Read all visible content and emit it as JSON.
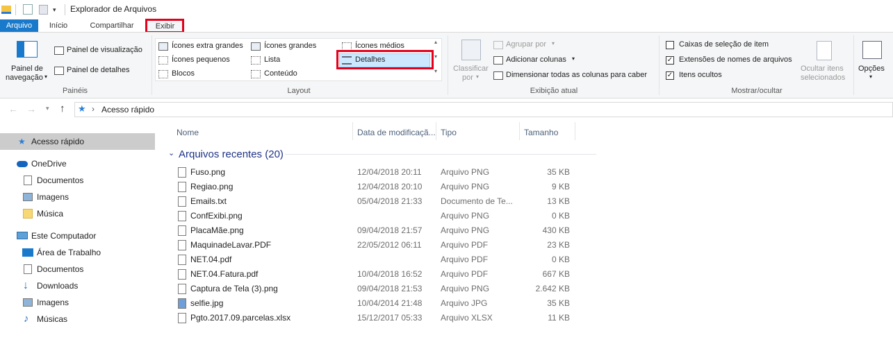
{
  "window": {
    "title": "Explorador de Arquivos"
  },
  "tabs": {
    "file": "Arquivo",
    "home": "Início",
    "share": "Compartilhar",
    "view": "Exibir"
  },
  "ribbon": {
    "panes": {
      "nav_pane": "Painel de",
      "nav_pane2": "navegação",
      "preview": "Painel de visualização",
      "details": "Painel de detalhes",
      "group": "Painéis"
    },
    "layout": {
      "xl": "Ícones extra grandes",
      "large": "Ícones grandes",
      "medium": "Ícones médios",
      "small": "Ícones pequenos",
      "list": "Lista",
      "details": "Detalhes",
      "tiles": "Blocos",
      "content": "Conteúdo",
      "group": "Layout"
    },
    "current": {
      "sort1": "Classificar",
      "sort2": "por",
      "group_by": "Agrupar por",
      "add_cols": "Adicionar colunas",
      "fit_cols": "Dimensionar todas as colunas para caber",
      "group": "Exibição atual"
    },
    "showhide": {
      "checkboxes": "Caixas de seleção de item",
      "extensions": "Extensões de nomes de arquivos",
      "hidden": "Itens ocultos",
      "hide_sel1": "Ocultar itens",
      "hide_sel2": "selecionados",
      "group": "Mostrar/ocultar"
    },
    "options": "Opções"
  },
  "address": {
    "path": "Acesso rápido"
  },
  "nav": [
    {
      "label": "Acesso rápido",
      "icon": "star-icon"
    },
    {
      "label": "OneDrive",
      "icon": "cloud-icon"
    },
    {
      "label": "Documentos",
      "icon": "document-icon"
    },
    {
      "label": "Imagens",
      "icon": "image-icon"
    },
    {
      "label": "Música",
      "icon": "folder-icon"
    },
    {
      "label": "Este Computador",
      "icon": "computer-icon"
    },
    {
      "label": "Área de Trabalho",
      "icon": "desktop-icon"
    },
    {
      "label": "Documentos",
      "icon": "document-icon"
    },
    {
      "label": "Downloads",
      "icon": "download-icon"
    },
    {
      "label": "Imagens",
      "icon": "image-icon"
    },
    {
      "label": "Músicas",
      "icon": "music-icon"
    }
  ],
  "columns": {
    "name": "Nome",
    "date": "Data de modificaçã...",
    "type": "Tipo",
    "size": "Tamanho"
  },
  "group_header": "Arquivos recentes (20)",
  "files": [
    {
      "name": "Fuso.png",
      "date": "12/04/2018 20:11",
      "type": "Arquivo PNG",
      "size": "35 KB"
    },
    {
      "name": "Regiao.png",
      "date": "12/04/2018 20:10",
      "type": "Arquivo PNG",
      "size": "9 KB"
    },
    {
      "name": "Emails.txt",
      "date": "05/04/2018 21:33",
      "type": "Documento de Te...",
      "size": "13 KB"
    },
    {
      "name": "ConfExibi.png",
      "date": "",
      "type": "Arquivo PNG",
      "size": "0 KB"
    },
    {
      "name": "PlacaMãe.png",
      "date": "09/04/2018 21:57",
      "type": "Arquivo PNG",
      "size": "430 KB"
    },
    {
      "name": "MaquinadeLavar.PDF",
      "date": "22/05/2012 06:11",
      "type": "Arquivo PDF",
      "size": "23 KB"
    },
    {
      "name": "NET.04.pdf",
      "date": "",
      "type": "Arquivo PDF",
      "size": "0 KB"
    },
    {
      "name": "NET.04.Fatura.pdf",
      "date": "10/04/2018 16:52",
      "type": "Arquivo PDF",
      "size": "667 KB"
    },
    {
      "name": "Captura de Tela (3).png",
      "date": "09/04/2018 21:53",
      "type": "Arquivo PNG",
      "size": "2.642 KB"
    },
    {
      "name": "selfie.jpg",
      "date": "10/04/2014 21:48",
      "type": "Arquivo JPG",
      "size": "35 KB"
    },
    {
      "name": "Pgto.2017.09.parcelas.xlsx",
      "date": "15/12/2017 05:33",
      "type": "Arquivo XLSX",
      "size": "11 KB"
    }
  ],
  "colors": {
    "accent": "#1979ca",
    "highlight": "#e3001b",
    "selection": "#cce8ff",
    "group_header": "#1e3287"
  }
}
